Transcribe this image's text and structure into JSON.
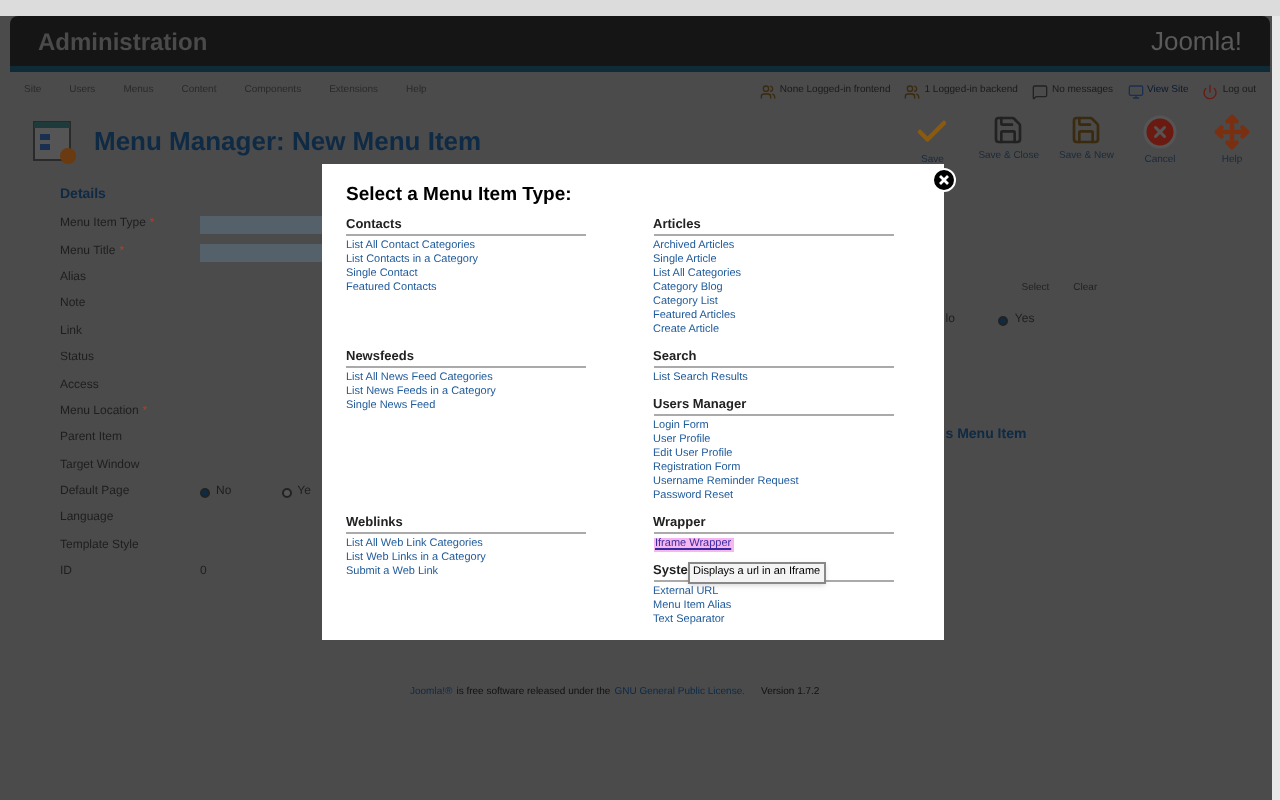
{
  "header": {
    "title": "Administration",
    "logo": "Joomla!"
  },
  "menu": [
    "Site",
    "Users",
    "Menus",
    "Content",
    "Components",
    "Extensions",
    "Help"
  ],
  "status": [
    {
      "text": "None Logged-in frontend",
      "kind": "users"
    },
    {
      "text": "1 Logged-in backend",
      "kind": "users"
    },
    {
      "text": "No messages",
      "kind": "mail"
    },
    {
      "text": "View Site",
      "kind": "site"
    },
    {
      "text": "Log out",
      "kind": "logout"
    }
  ],
  "page_title": "Menu Manager: New Menu Item",
  "toolbar": [
    {
      "label": "Save",
      "kind": "check"
    },
    {
      "label": "Save & Close",
      "kind": "disk"
    },
    {
      "label": "Save & New",
      "kind": "disk-new"
    },
    {
      "label": "Cancel",
      "kind": "cancel"
    },
    {
      "label": "Help",
      "kind": "help"
    }
  ],
  "form": {
    "legend": "Details",
    "fields": [
      {
        "label": "Menu Item Type",
        "required_mark": "*",
        "kind": "input"
      },
      {
        "label": "Menu Title",
        "required_mark": "*",
        "kind": "input"
      },
      {
        "label": "Alias",
        "kind": "blank"
      },
      {
        "label": "Note",
        "kind": "blank"
      },
      {
        "label": "Link",
        "kind": "blank"
      },
      {
        "label": "Status",
        "kind": "blank"
      },
      {
        "label": "Access",
        "kind": "blank"
      },
      {
        "label": "Menu Location",
        "required_mark": "*",
        "kind": "blank"
      },
      {
        "label": "Parent Item",
        "kind": "blank"
      },
      {
        "label": "Target Window",
        "kind": "blank"
      },
      {
        "label": "Default Page",
        "kind": "radio",
        "options": [
          {
            "label": "No",
            "selected": true
          },
          {
            "label": "Ye",
            "selected": false
          }
        ]
      },
      {
        "label": "Language",
        "kind": "blank"
      },
      {
        "label": "Template Style",
        "kind": "blank"
      },
      {
        "label": "ID",
        "kind": "text",
        "value": "0"
      }
    ]
  },
  "right_panel": {
    "buttons": [
      "Select",
      "Clear"
    ],
    "radios": [
      {
        "label": "lo"
      },
      {
        "label": "Yes",
        "selected": true
      }
    ],
    "link": "s Menu Item"
  },
  "modal": {
    "title": "Select a Menu Item Type:",
    "rows": [
      [
        [
          {
            "heading": "Contacts",
            "items": [
              {
                "label": "List All Contact Categories",
                "highlighted": false
              },
              {
                "label": "List Contacts in a Category",
                "highlighted": false
              },
              {
                "label": "Single Contact",
                "highlighted": false
              },
              {
                "label": "Featured Contacts",
                "highlighted": false
              }
            ]
          }
        ],
        [
          {
            "heading": "Articles",
            "items": [
              {
                "label": "Archived Articles",
                "highlighted": false
              },
              {
                "label": "Single Article",
                "highlighted": false
              },
              {
                "label": "List All Categories",
                "highlighted": false
              },
              {
                "label": "Category Blog",
                "highlighted": false
              },
              {
                "label": "Category List",
                "highlighted": false
              },
              {
                "label": "Featured Articles",
                "highlighted": false
              },
              {
                "label": "Create Article",
                "highlighted": false
              }
            ]
          }
        ]
      ],
      [
        [
          {
            "heading": "Newsfeeds",
            "items": [
              {
                "label": "List All News Feed Categories",
                "highlighted": false
              },
              {
                "label": "List News Feeds in a Category",
                "highlighted": false
              },
              {
                "label": "Single News Feed",
                "highlighted": false
              }
            ]
          }
        ],
        [
          {
            "heading": "Search",
            "items": [
              {
                "label": "List Search Results",
                "highlighted": false
              }
            ]
          },
          {
            "heading": "Users Manager",
            "items": [
              {
                "label": "Login Form",
                "highlighted": false
              },
              {
                "label": "User Profile",
                "highlighted": false
              },
              {
                "label": "Edit User Profile",
                "highlighted": false
              },
              {
                "label": "Registration Form",
                "highlighted": false
              },
              {
                "label": "Username Reminder Request",
                "highlighted": false
              },
              {
                "label": "Password Reset",
                "highlighted": false
              }
            ]
          }
        ]
      ],
      [
        [
          {
            "heading": "Weblinks",
            "items": [
              {
                "label": "List All Web Link Categories",
                "highlighted": false
              },
              {
                "label": "List Web Links in a Category",
                "highlighted": false
              },
              {
                "label": "Submit a Web Link",
                "highlighted": false
              }
            ]
          }
        ],
        [
          {
            "heading": "Wrapper",
            "items": [
              {
                "label": "Iframe Wrapper",
                "highlighted": true
              }
            ]
          },
          {
            "heading": "Syste",
            "tooltip": "Displays a url in an Iframe",
            "items": [
              {
                "label": "External URL",
                "highlighted": false
              },
              {
                "label": "Menu Item Alias",
                "highlighted": false
              },
              {
                "label": "Text Separator",
                "highlighted": false
              }
            ]
          }
        ]
      ]
    ]
  },
  "footer": {
    "parts": [
      {
        "text": "Joomla!®",
        "kind": "link"
      },
      {
        "text": "is free software released under the",
        "kind": "text"
      },
      {
        "text": "GNU General Public License.",
        "kind": "link"
      }
    ],
    "version": "Version 1.7.2"
  }
}
